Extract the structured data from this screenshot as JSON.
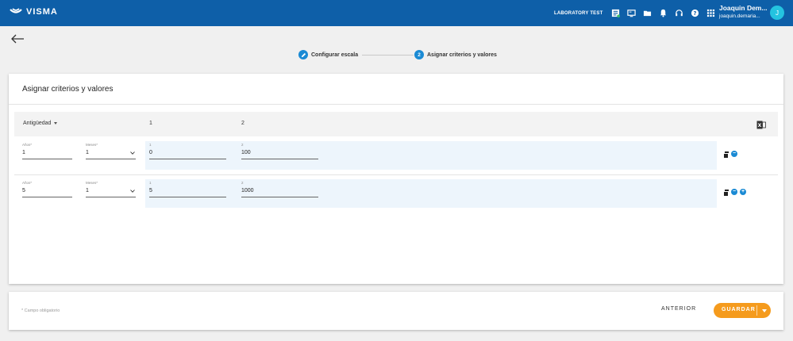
{
  "header": {
    "brand": "VISMA",
    "environment": "LABORATORY TEST",
    "user_name": "Joaquin Dem...",
    "user_email": "joaquin.demaria...",
    "avatar_initial": "J",
    "icons": [
      "report-icon",
      "monitor-icon",
      "folder-icon",
      "bell-icon",
      "headset-icon",
      "help-icon",
      "apps-grid-icon"
    ]
  },
  "stepper": {
    "steps": [
      {
        "label": "Configurar escala",
        "marker": "pencil-icon",
        "state": "completed"
      },
      {
        "label": "Asignar criterios y valores",
        "marker": "2",
        "state": "active"
      }
    ]
  },
  "card": {
    "title": "Asignar criterios y valores",
    "columns": [
      "Antigüedad",
      "1",
      "2"
    ],
    "rows": [
      {
        "anios_label": "Años*",
        "anios_value": "1",
        "meses_label": "Meses*",
        "meses_value": "1",
        "col1_label": "1",
        "col1_value": "0",
        "col2_label": "2",
        "col2_value": "100"
      },
      {
        "anios_label": "Años*",
        "anios_value": "5",
        "meses_label": "Meses*",
        "meses_value": "1",
        "col1_label": "1",
        "col1_value": "5",
        "col2_label": "2",
        "col2_value": "1000"
      }
    ]
  },
  "footer": {
    "required_note": "* Campo obligatorio",
    "prev_label": "ANTERIOR",
    "save_label": "GUARDAR"
  },
  "colors": {
    "header_bg": "#0e5fa8",
    "accent": "#1a8ad4",
    "save_button": "#f59b1d",
    "avatar": "#24c3e0"
  }
}
